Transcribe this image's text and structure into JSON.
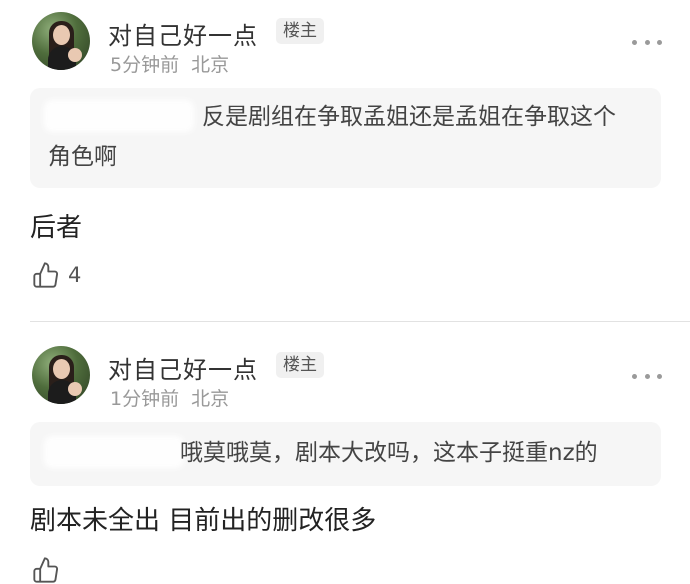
{
  "comments": [
    {
      "username": "对自己好一点",
      "badge": "楼主",
      "time": "5分钟前",
      "location": "北京",
      "quote_line1": "反是剧组在争取孟姐还是孟姐在争取这个",
      "quote_line2": "角色啊",
      "content": "后者",
      "likes": "4"
    },
    {
      "username": "对自己好一点",
      "badge": "楼主",
      "time": "1分钟前",
      "location": "北京",
      "quote_line1": "哦莫哦莫，剧本大改吗，这本子挺重nz的",
      "content": "剧本未全出 目前出的删改很多"
    }
  ],
  "icons": {
    "more": "more-dots-icon",
    "like": "thumbs-up-icon"
  }
}
